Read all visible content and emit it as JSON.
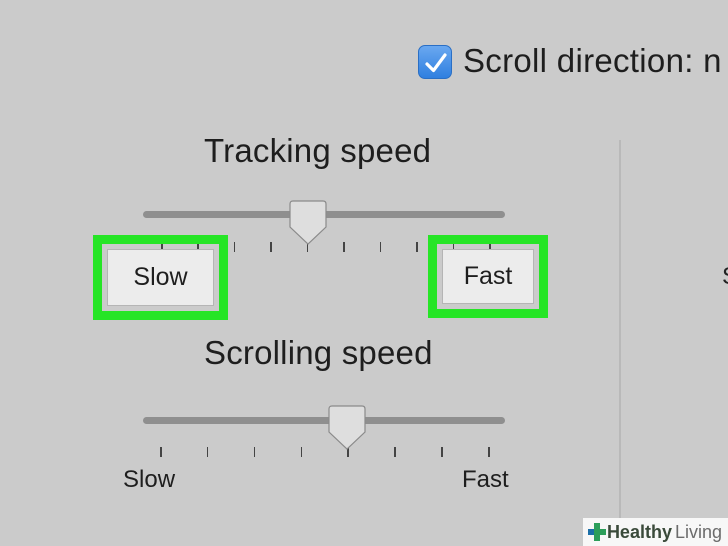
{
  "checkbox": {
    "checked": true,
    "label": "Scroll direction: n"
  },
  "right_panel": {
    "partial_text": "S"
  },
  "tracking": {
    "title": "Tracking speed",
    "slow_label": "Slow",
    "fast_label": "Fast",
    "level": 0.45,
    "tick_count": 10
  },
  "scrolling": {
    "title": "Scrolling speed",
    "slow_label": "Slow",
    "fast_label": "Fast",
    "level": 0.57,
    "tick_count": 8
  },
  "watermark": {
    "brand": "Healthy",
    "suffix": "Living"
  },
  "colors": {
    "highlight": "#26e526",
    "checkbox": "#2f7fe0",
    "background": "#cbcbcb"
  }
}
